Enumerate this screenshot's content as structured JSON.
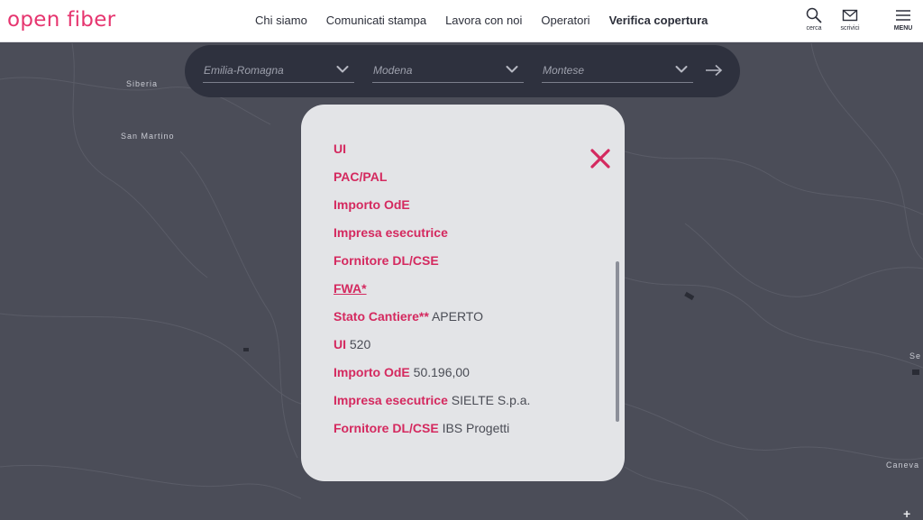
{
  "header": {
    "logo": "open fiber",
    "nav": [
      "Chi siamo",
      "Comunicati stampa",
      "Lavora con noi",
      "Operatori",
      "Verifica copertura"
    ],
    "search_label": "cerca",
    "write_label": "scrivici",
    "menu_label": "MENU"
  },
  "map": {
    "places": [
      "Siberia",
      "San Martino",
      "Se",
      "Caneva"
    ]
  },
  "selectors": {
    "region": "Emilia-Romagna",
    "province": "Modena",
    "municipality": "Montese"
  },
  "modal": {
    "rows": [
      {
        "key": "UI",
        "value": ""
      },
      {
        "key": "PAC/PAL",
        "value": ""
      },
      {
        "key": "Importo OdE",
        "value": ""
      },
      {
        "key": "Impresa esecutrice",
        "value": ""
      },
      {
        "key": "Fornitore DL/CSE",
        "value": ""
      },
      {
        "key": "FWA*",
        "value": ""
      },
      {
        "key": "Stato Cantiere**",
        "value": "APERTO"
      },
      {
        "key": "UI",
        "value": "520"
      },
      {
        "key": "Importo OdE",
        "value": "50.196,00"
      },
      {
        "key": "Impresa esecutrice",
        "value": "SIELTE S.p.a."
      },
      {
        "key": "Fornitore DL/CSE",
        "value": "IBS Progetti"
      }
    ]
  },
  "colors": {
    "brand": "#e6356f",
    "accent": "#d4295f",
    "map_bg": "#4b4d58",
    "bar_bg": "#2e313e",
    "modal_bg": "#e3e4e7"
  },
  "icons": [
    "search-icon",
    "mail-icon",
    "hamburger-icon",
    "chevron-down-icon",
    "arrow-right-icon",
    "close-icon",
    "zoom-plus-icon"
  ]
}
